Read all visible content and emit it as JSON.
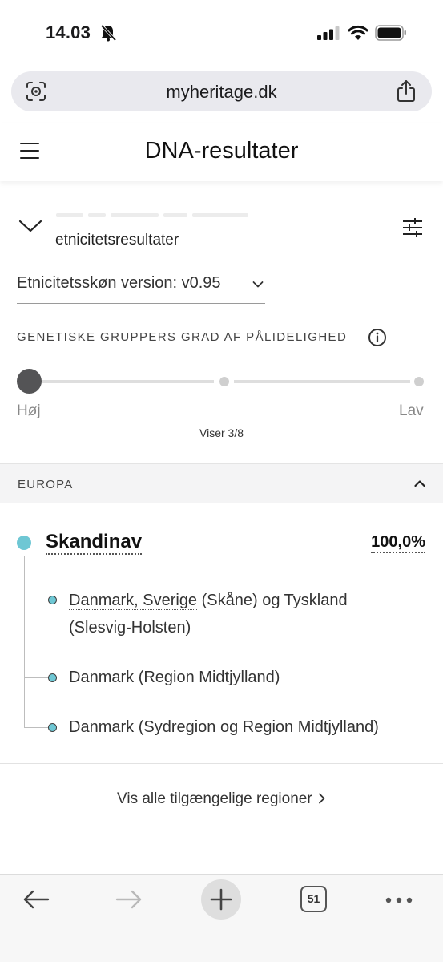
{
  "status_bar": {
    "time": "14.03",
    "icons": [
      "bell-slash-icon",
      "cellular-signal-icon",
      "wifi-icon",
      "battery-icon"
    ]
  },
  "browser": {
    "url": "myheritage.dk",
    "icons": [
      "lens-icon",
      "share-icon"
    ]
  },
  "header": {
    "title": "DNA-resultater",
    "menu_icon": "hamburger-icon"
  },
  "filters": {
    "section_label": "etnicitetsresultater",
    "version_select": "Etnicitetsskøn version: v0.95",
    "confidence_label": "GENETISKE GRUPPERS GRAD AF PÅLIDELIGHED",
    "slider_high": "Høj",
    "slider_low": "Lav",
    "slider_stops": 3,
    "slider_value_index": 0,
    "showing": "Viser 3/8"
  },
  "region": {
    "title": "EUROPA",
    "ethnicity": {
      "name": "Skandinav",
      "percent": "100,0%",
      "dot_color": "#6ec7d4",
      "sub_regions": [
        {
          "link": "Danmark, Sverige",
          "text": "Danmark, Sverige (Skåne) og Tyskland (Slesvig-Holsten)"
        },
        {
          "text": "Danmark (Region Midtjylland)"
        },
        {
          "text": "Danmark (Sydregion og Region Midtjylland)"
        }
      ]
    },
    "show_all": "Vis alle tilgængelige regioner"
  },
  "toolbar": {
    "tab_count": "51",
    "icons": [
      "back-arrow-icon",
      "forward-arrow-icon",
      "plus-icon",
      "tabs-icon",
      "more-icon"
    ]
  }
}
